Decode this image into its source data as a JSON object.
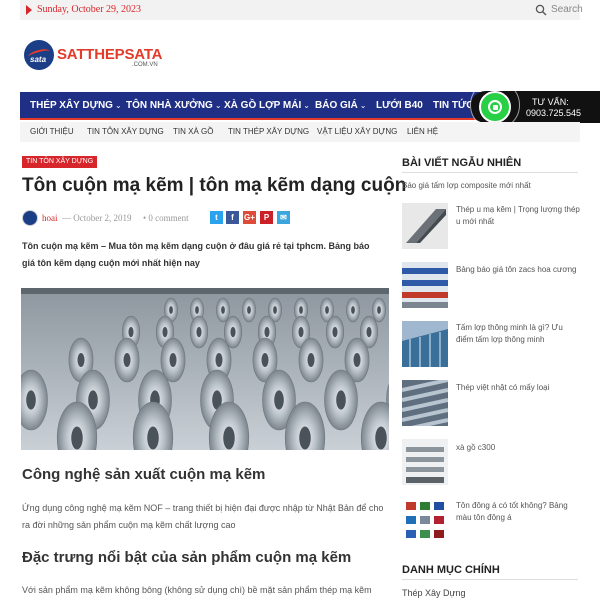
{
  "topbar": {
    "date": "Sunday, October 29, 2023",
    "search_placeholder": "Search"
  },
  "logo": {
    "badge_text": "sata",
    "name": "SATTHEPSATA",
    "sub": ".COM.VN"
  },
  "mainnav": {
    "items": [
      {
        "label": "THÉP XÂY DỰNG",
        "has_dropdown": true
      },
      {
        "label": "TÔN NHÀ XƯỞNG",
        "has_dropdown": true
      },
      {
        "label": "XÀ GỒ LỢP MÁI",
        "has_dropdown": true
      },
      {
        "label": "BÁO GIÁ",
        "has_dropdown": true
      },
      {
        "label": "LƯỚI B40",
        "has_dropdown": false
      },
      {
        "label": "TIN TỨC",
        "has_dropdown": true
      }
    ],
    "dropdown_chevron": "⌄"
  },
  "hotline": {
    "label": "TƯ VẤN:",
    "number": "0903.725.545",
    "icon": "whatsapp-icon"
  },
  "subnav": {
    "items": [
      "GIỚI THIỆU",
      "TIN TÔN XÂY DỰNG",
      "TIN XÀ GỒ",
      "TIN THÉP XÂY DỰNG",
      "VẬT LIỆU XÂY DỰNG",
      "LIÊN HỆ"
    ]
  },
  "article": {
    "category": "TIN TÔN XÂY DỰNG",
    "title": "Tôn cuộn mạ kẽm | tôn mạ kẽm dạng cuộn",
    "author": "hoai",
    "date": "— October 2, 2019",
    "comments": "• 0 comment",
    "share": [
      {
        "name": "twitter",
        "glyph": "t",
        "color": "#2aa3ef"
      },
      {
        "name": "facebook",
        "glyph": "f",
        "color": "#3b5998"
      },
      {
        "name": "google-plus",
        "glyph": "G+",
        "color": "#dd4b39"
      },
      {
        "name": "pinterest",
        "glyph": "P",
        "color": "#cb2027"
      },
      {
        "name": "email",
        "glyph": "✉",
        "color": "#3aa6dd"
      }
    ],
    "lead": "Tôn cuộn mạ kẽm – Mua tôn mạ kẽm dạng cuộn ở đâu giá rẻ tại tphcm. Bảng báo giá tôn kẽm dạng cuộn mới nhất hiện nay",
    "heading1": "Công nghệ sản xuất cuộn mạ kẽm",
    "para1": "Ứng dụng công nghệ mạ kẽm NOF – trang thiết bị hiện đại được nhập từ Nhật Bản để cho ra đời những sản phẩm cuộn mạ kẽm chất lượng cao",
    "heading2": "Đặc trưng nổi bật của sản phẩm cuộn mạ kẽm",
    "para2": "Với sản phẩm mạ kẽm không bông (không sử dụng chì) bề mặt sản phẩm thép mạ kẽm"
  },
  "sidebar": {
    "heading": "BÀI VIẾT NGẪU NHIÊN",
    "first": "Báo giá tấm lợp composite mới nhất",
    "items": [
      {
        "label": "Thép u mạ kẽm | Trọng lượng thép u mới nhất",
        "thumb": "steel-channel-thumb"
      },
      {
        "label": "Bảng báo giá tôn zacs hoa cương",
        "thumb": "roof-sheet-thumb"
      },
      {
        "label": "Tấm lợp thông minh là gì? Ưu điểm tấm lợp thông minh",
        "thumb": "building-thumb"
      },
      {
        "label": "Thép việt nhật có mấy loại",
        "thumb": "rebar-thumb"
      },
      {
        "label": "xà gồ c300",
        "thumb": "purlin-thumb"
      },
      {
        "label": "Tôn đông á có tốt không? Bảng màu tôn đông á",
        "thumb": "color-chart-thumb"
      }
    ],
    "heading2": "DANH MỤC CHÍNH",
    "category": "Thép Xây Dựng"
  },
  "colors": {
    "brand_red": "#d6262b",
    "nav_blue": "#1f2f86",
    "whatsapp_green": "#27d045"
  }
}
